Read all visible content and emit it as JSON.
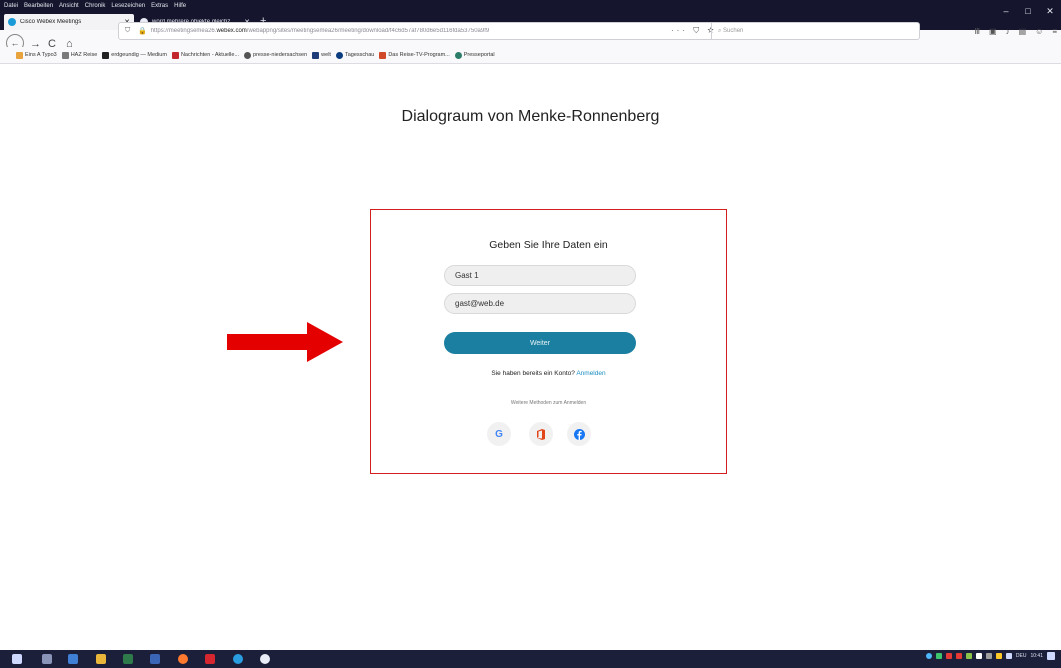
{
  "browser": {
    "menu": [
      "Datei",
      "Bearbeiten",
      "Ansicht",
      "Chronik",
      "Lesezeichen",
      "Extras",
      "Hilfe"
    ],
    "window_controls": {
      "minimize": "–",
      "maximize": "□",
      "close": "✕"
    },
    "tabs": [
      {
        "title": "Cisco Webex Meetings",
        "close": "✕",
        "favicon_color": "#1a9bd7",
        "active": true
      },
      {
        "title": "word mehrere objekte gleichz",
        "close": "✕",
        "favicon_color": "#e8eaf6",
        "active": false
      }
    ],
    "new_tab": "+",
    "nav": {
      "back": "←",
      "forward": "→",
      "reload": "C",
      "home": "⌂"
    },
    "url": {
      "prefix": "https://meetingsemea26.",
      "domain": "webex.com",
      "path": "/webappng/sites/meetingsemea26/meeting/download/f4c6d57af780d6e5d116fda53750a9f9"
    },
    "page_actions": "··· ⛉ ☆",
    "search_placeholder": "Suchen",
    "toolbar_icons": [
      "Ⅲ",
      "▣",
      "♪",
      "▤",
      "☺",
      "≡"
    ],
    "bookmarks": [
      {
        "label": "Eins A Typo3",
        "color": "#e8a33d"
      },
      {
        "label": "HAZ Reise",
        "color": "#7a7a7a"
      },
      {
        "label": "erdgeundig — Medium",
        "color": "#222222"
      },
      {
        "label": "Nachrichten - Aktuelle...",
        "color": "#c2272d"
      },
      {
        "label": "presse-niedersachsen",
        "color": "#555555"
      },
      {
        "label": "welt",
        "color": "#1d3c78"
      },
      {
        "label": "Tagesschau",
        "color": "#0b3d7e"
      },
      {
        "label": "Das Reise-TV-Program...",
        "color": "#d04a2a"
      },
      {
        "label": "Presseportal",
        "color": "#2e7d6b"
      }
    ]
  },
  "page": {
    "title": "Dialograum von Menke-Ronnenberg",
    "dialog": {
      "heading": "Geben Sie Ihre Daten ein",
      "name_value": "Gast 1",
      "email_value": "gast@web.de",
      "submit_label": "Weiter",
      "account_text": "Sie haben bereits ein Konto?",
      "signin_link": "Anmelden",
      "other_methods": "Weitere Methoden zum Anmelden",
      "providers": [
        "google-icon",
        "office-icon",
        "facebook-icon"
      ],
      "colors": {
        "button": "#1a7fa0",
        "link": "#1a8cc2",
        "frame": "#d41f1f"
      }
    },
    "annotation_arrow_color": "#e50000"
  },
  "taskbar": {
    "apps": [
      "start-icon",
      "task-view-icon",
      "file-explorer-icon",
      "folder-icon",
      "excel-icon",
      "word-icon",
      "firefox-icon",
      "acrobat-icon",
      "skype-icon",
      "app-icon"
    ],
    "language": "DEU",
    "time": "10:41"
  }
}
